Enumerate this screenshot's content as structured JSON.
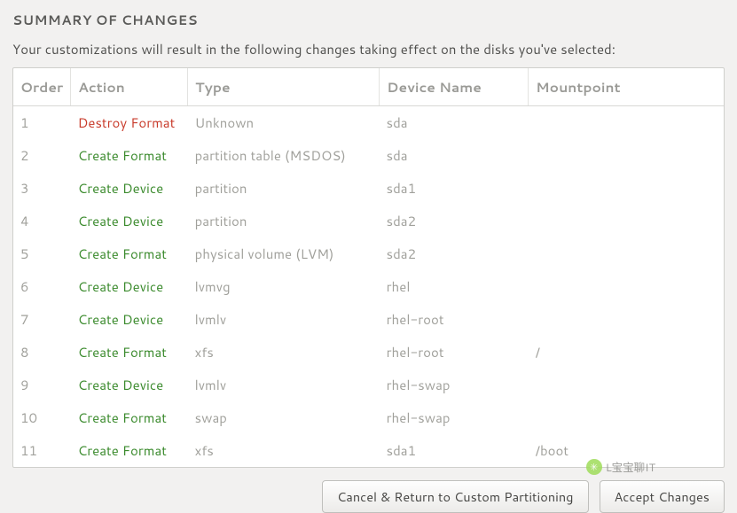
{
  "header": {
    "title": "SUMMARY OF CHANGES",
    "subtitle": "Your customizations will result in the following changes taking effect on the disks you've selected:"
  },
  "table": {
    "columns": {
      "order": "Order",
      "action": "Action",
      "type": "Type",
      "device": "Device Name",
      "mount": "Mountpoint"
    },
    "rows": [
      {
        "order": "1",
        "action": "Destroy Format",
        "action_kind": "destroy",
        "type": "Unknown",
        "device": "sda",
        "mount": ""
      },
      {
        "order": "2",
        "action": "Create Format",
        "action_kind": "create",
        "type": "partition table (MSDOS)",
        "device": "sda",
        "mount": ""
      },
      {
        "order": "3",
        "action": "Create Device",
        "action_kind": "create",
        "type": "partition",
        "device": "sda1",
        "mount": ""
      },
      {
        "order": "4",
        "action": "Create Device",
        "action_kind": "create",
        "type": "partition",
        "device": "sda2",
        "mount": ""
      },
      {
        "order": "5",
        "action": "Create Format",
        "action_kind": "create",
        "type": "physical volume (LVM)",
        "device": "sda2",
        "mount": ""
      },
      {
        "order": "6",
        "action": "Create Device",
        "action_kind": "create",
        "type": "lvmvg",
        "device": "rhel",
        "mount": ""
      },
      {
        "order": "7",
        "action": "Create Device",
        "action_kind": "create",
        "type": "lvmlv",
        "device": "rhel-root",
        "mount": ""
      },
      {
        "order": "8",
        "action": "Create Format",
        "action_kind": "create",
        "type": "xfs",
        "device": "rhel-root",
        "mount": "/"
      },
      {
        "order": "9",
        "action": "Create Device",
        "action_kind": "create",
        "type": "lvmlv",
        "device": "rhel-swap",
        "mount": ""
      },
      {
        "order": "10",
        "action": "Create Format",
        "action_kind": "create",
        "type": "swap",
        "device": "rhel-swap",
        "mount": ""
      },
      {
        "order": "11",
        "action": "Create Format",
        "action_kind": "create",
        "type": "xfs",
        "device": "sda1",
        "mount": "/boot"
      }
    ]
  },
  "buttons": {
    "cancel": "Cancel & Return to Custom Partitioning",
    "accept": "Accept Changes"
  },
  "watermark": {
    "text": "L宝宝聊IT"
  }
}
